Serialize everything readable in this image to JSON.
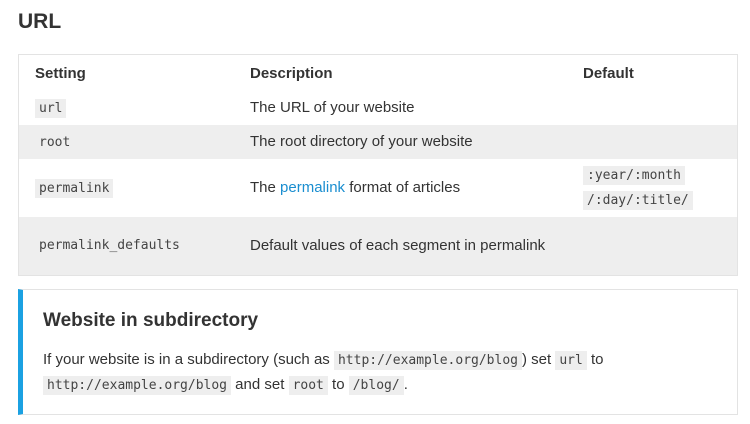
{
  "section_title": "URL",
  "table": {
    "headers": {
      "setting": "Setting",
      "description": "Description",
      "default": "Default"
    },
    "rows": [
      {
        "setting": "url",
        "description": "The URL of your website",
        "default": ""
      },
      {
        "setting": "root",
        "description": "The root directory of your website",
        "default": ""
      },
      {
        "setting": "permalink",
        "description_before": "The ",
        "description_link": "permalink",
        "description_after": " format of articles",
        "default_line1": ":year/:month",
        "default_line2": "/:day/:title/"
      },
      {
        "setting": "permalink_defaults",
        "description": "Default values of each segment in permalink",
        "default": ""
      }
    ]
  },
  "note": {
    "title": "Website in subdirectory",
    "text1": "If your website is in a subdirectory (such as ",
    "code1": "http://example.org/blog",
    "text2": ") set ",
    "code2": "url",
    "text3": " to ",
    "code3": "http://example.org/blog",
    "text4": " and set ",
    "code4": "root",
    "text5": " to ",
    "code5": "/blog/",
    "text6": "."
  },
  "colors": {
    "accent": "#1ba1e2",
    "link": "#1a8ed0",
    "row_stripe": "#eeeeee"
  }
}
